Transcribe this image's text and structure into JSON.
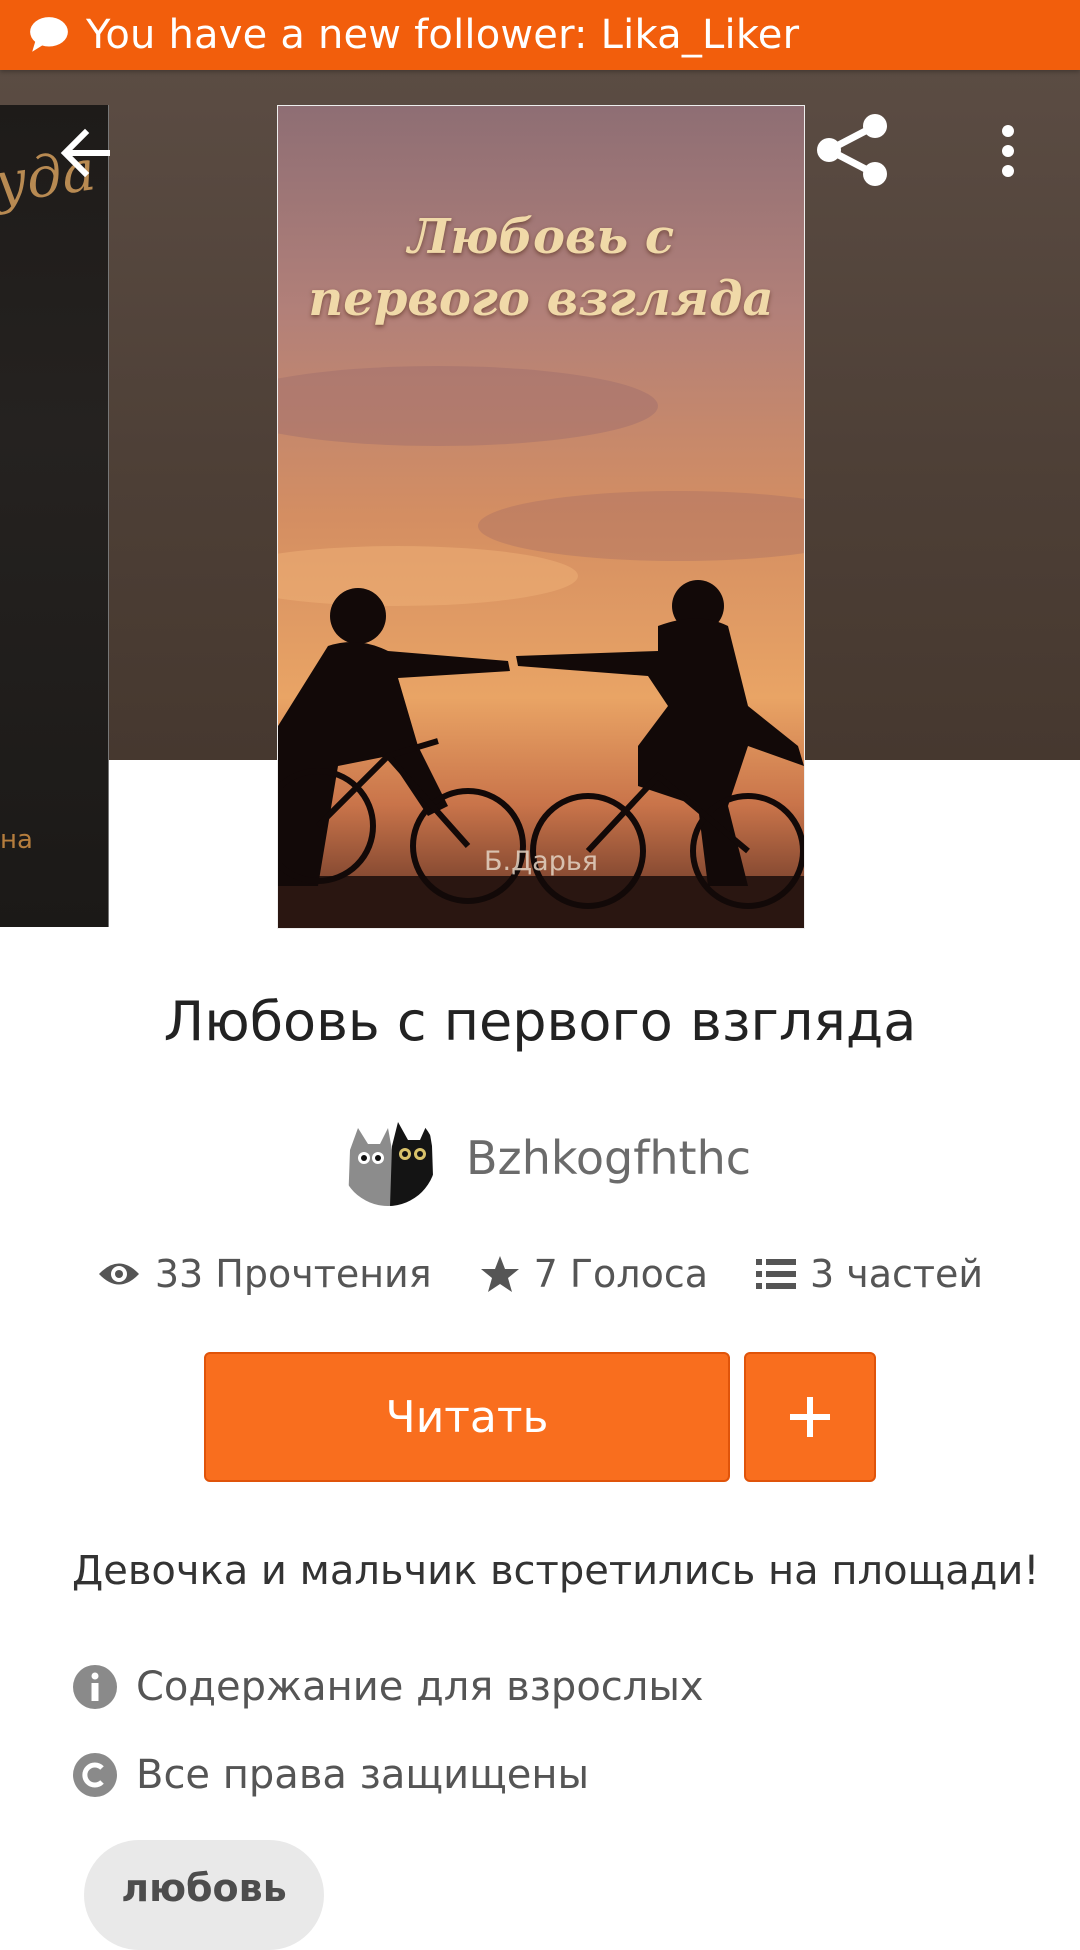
{
  "notification": {
    "icon": "chat-bubble-icon",
    "text": "You have a new follower: Lika_Liker",
    "background": "#F25E0C"
  },
  "toolbar": {
    "back_icon": "arrow-left-icon",
    "share_icon": "share-icon",
    "more_icon": "more-vertical-icon"
  },
  "cover": {
    "title_line1": "Любовь с",
    "title_line2": "первого взгляда",
    "author": "Б.Дарья"
  },
  "story": {
    "title": "Любовь с первого взгляда",
    "author": "Bzhkogfhthc",
    "description": "Девочка и мальчик встретились на площади!"
  },
  "stats": {
    "reads": "33 Прочтения",
    "votes": "7 Голоса",
    "parts": "3 частей"
  },
  "actions": {
    "read_label": "Читать",
    "add_label": "+",
    "accent": "#F96E1E"
  },
  "info": {
    "mature": "Содержание для взрослых",
    "copyright": "Все права защищены"
  },
  "tags": [
    "любовь"
  ]
}
